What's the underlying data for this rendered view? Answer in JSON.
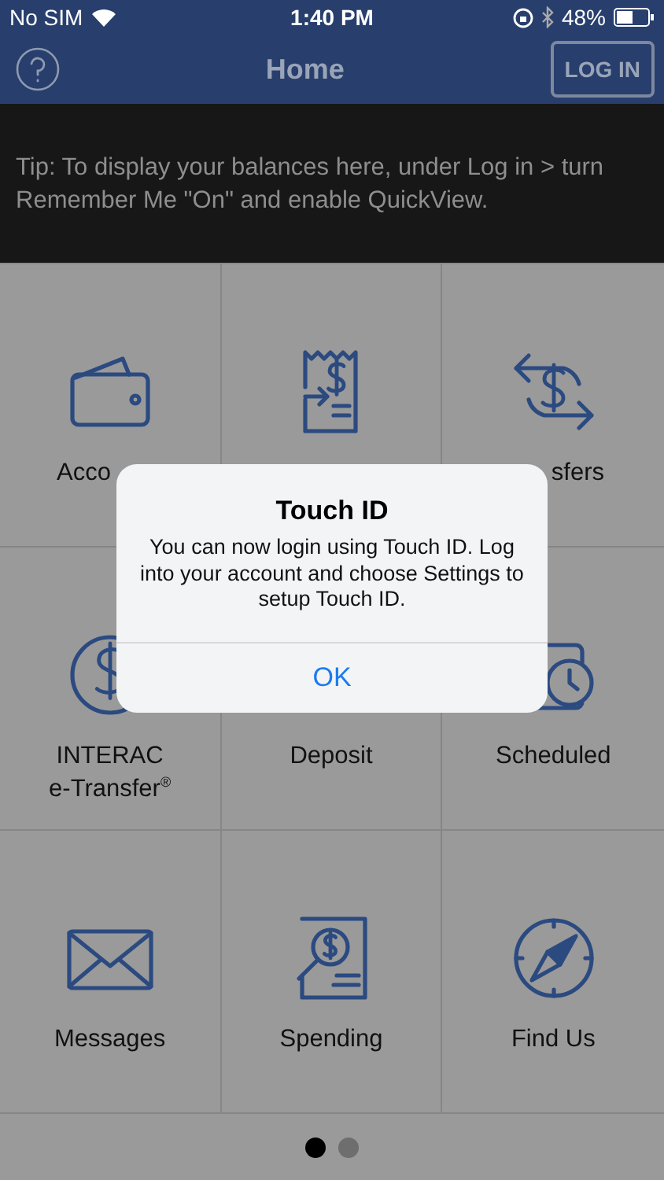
{
  "status_bar": {
    "carrier": "No SIM",
    "time": "1:40 PM",
    "battery": "48%"
  },
  "nav": {
    "title": "Home",
    "login": "LOG IN"
  },
  "tip": "Tip: To display your balances here, under Log in > turn Remember Me \"On\" and enable QuickView.",
  "tiles": [
    {
      "kind": "wallet",
      "label": "Acco"
    },
    {
      "kind": "bill"
    },
    {
      "kind": "transfer",
      "label": "sfers"
    },
    {
      "kind": "coin",
      "label": "INTERAC",
      "sublabel": "e-Transfer$^{®}$"
    },
    {
      "kind": "deposit",
      "label": "Deposit"
    },
    {
      "kind": "scheduled",
      "label": "Scheduled"
    },
    {
      "kind": "envelope",
      "label": "Messages"
    },
    {
      "kind": "spending",
      "label": "Spending"
    },
    {
      "kind": "compass",
      "label": "Find Us"
    }
  ],
  "pages": [
    {
      "selected": true
    },
    {
      "selected": false
    }
  ],
  "dialog": {
    "title": "Touch ID",
    "message": "You can now login using Touch ID. Log into your account and choose Settings to setup Touch ID.",
    "button": "OK"
  }
}
